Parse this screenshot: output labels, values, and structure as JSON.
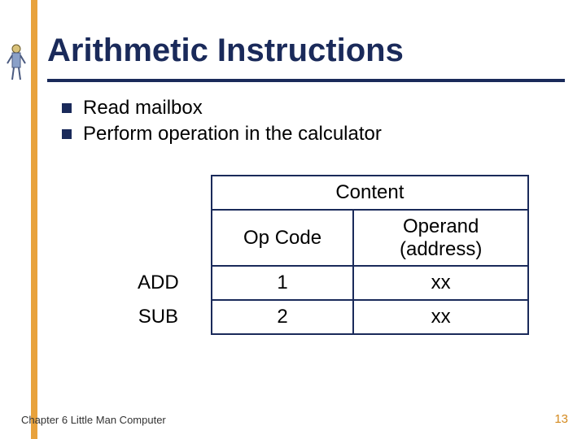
{
  "title": "Arithmetic Instructions",
  "bullets": [
    "Read mailbox",
    "Perform operation in the calculator"
  ],
  "chart_data": {
    "type": "table",
    "header_top": "Content",
    "columns": [
      "",
      "Op Code",
      "Operand\n(address)"
    ],
    "rows": [
      {
        "label": "ADD",
        "opcode": "1",
        "operand": "xx"
      },
      {
        "label": "SUB",
        "opcode": "2",
        "operand": "xx"
      }
    ]
  },
  "footer": {
    "chapter": "Chapter 6 Little Man Computer",
    "page": "13"
  },
  "colors": {
    "navy": "#1a2a5a",
    "accent": "#e8a23c"
  }
}
